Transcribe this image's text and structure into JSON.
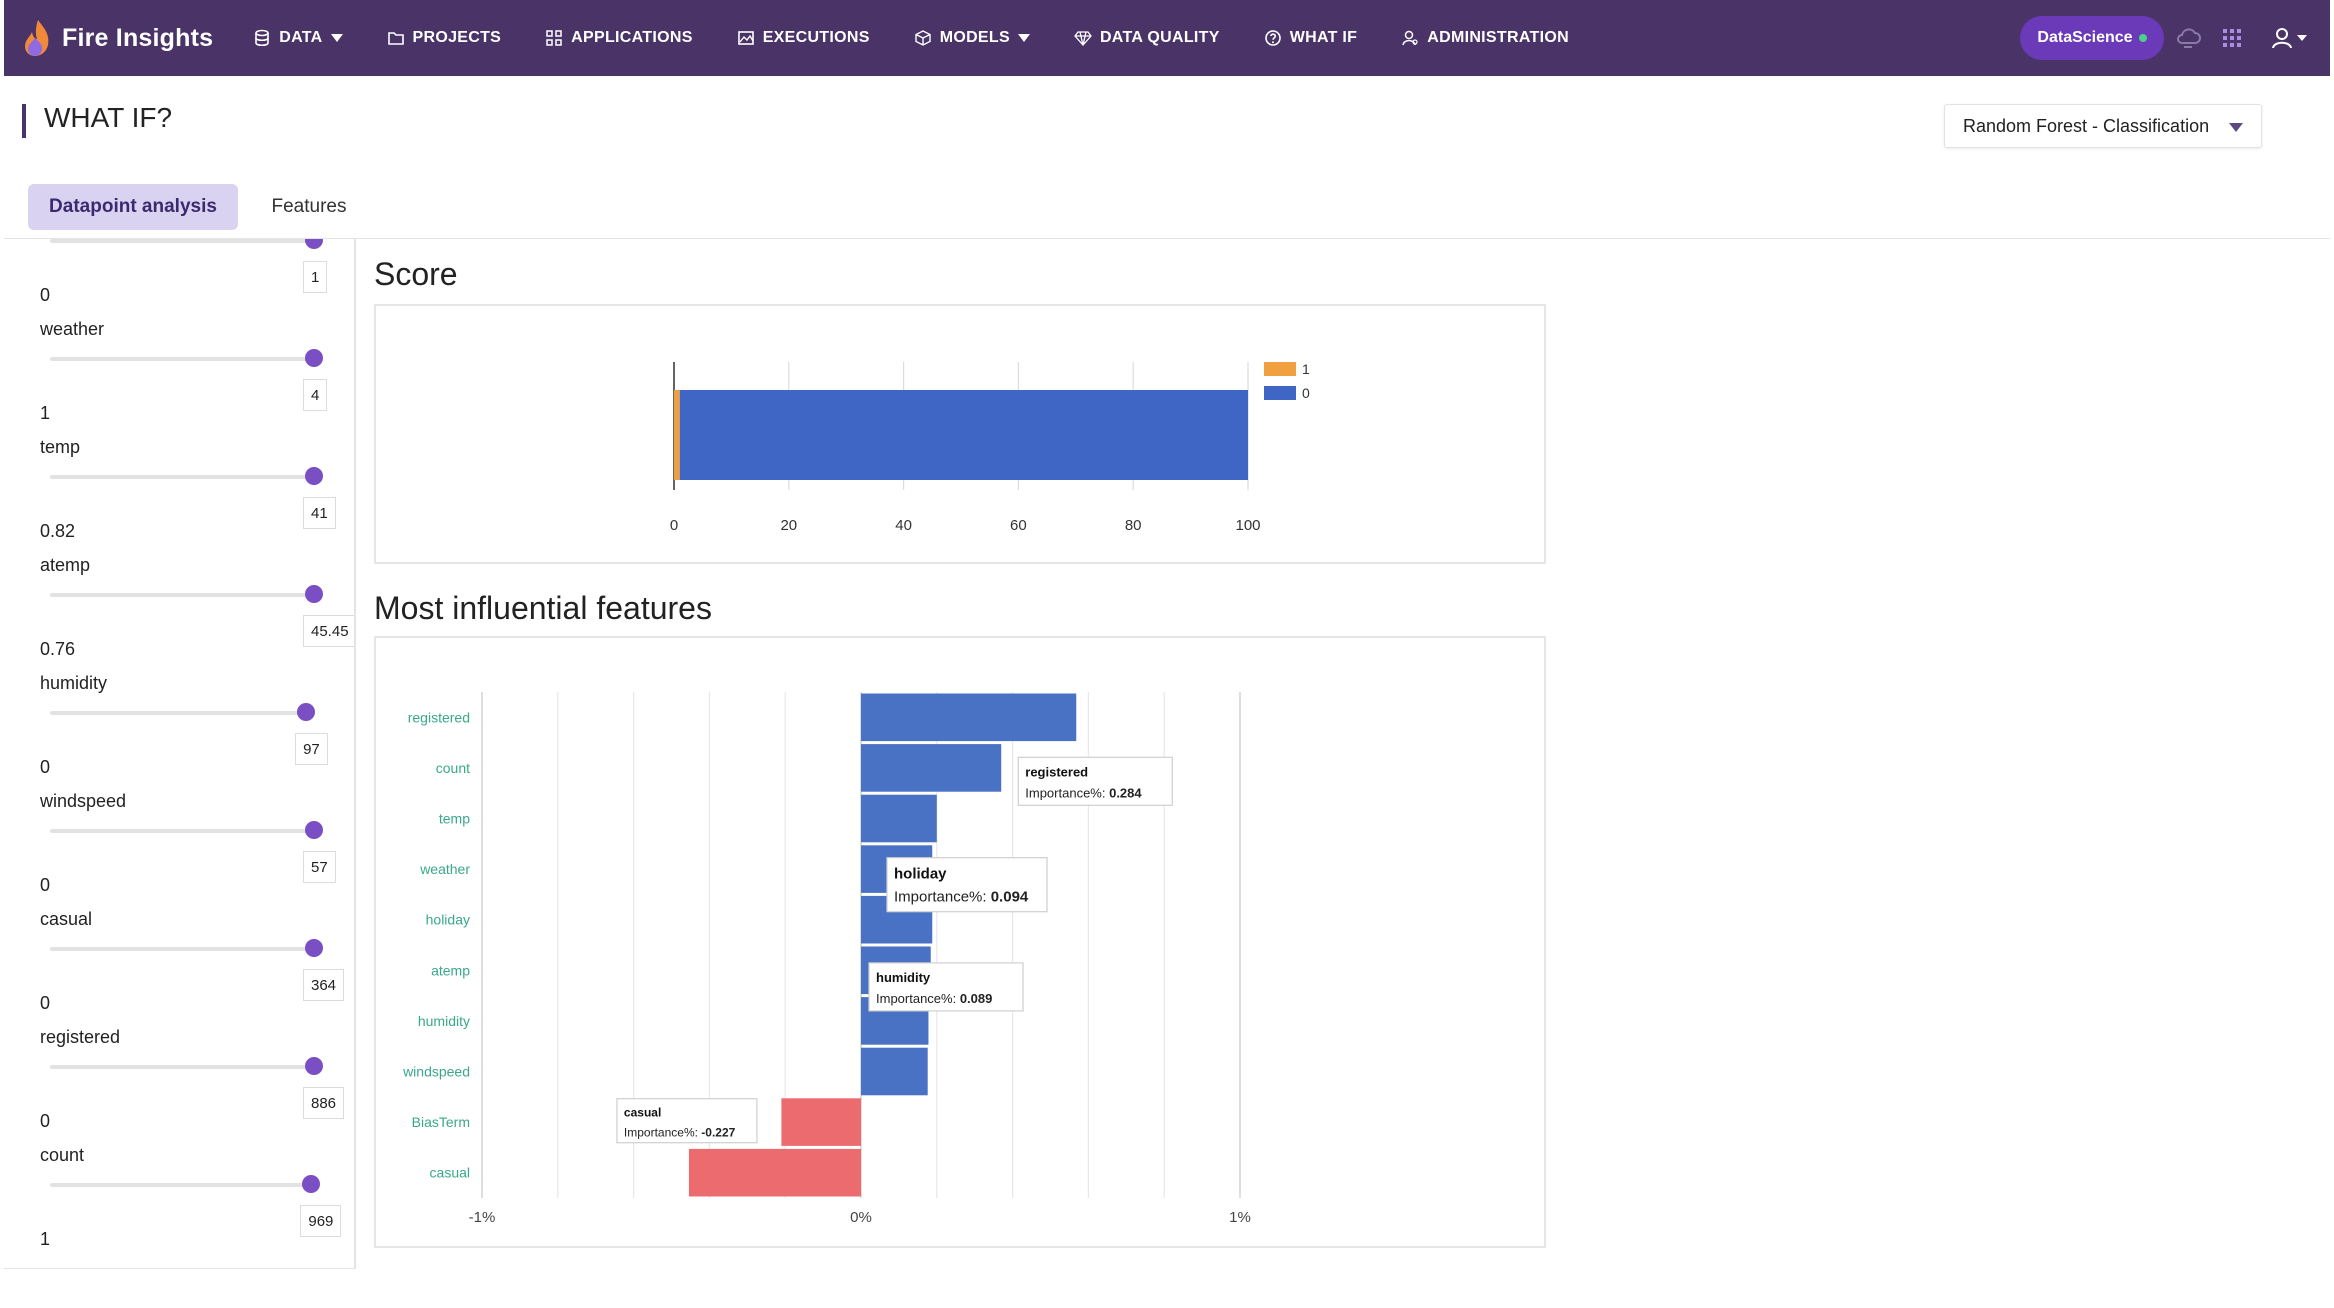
{
  "app": {
    "title": "Fire Insights",
    "nav": [
      {
        "label": "DATA",
        "icon": "database-icon",
        "dropdown": true
      },
      {
        "label": "PROJECTS",
        "icon": "folder-icon",
        "dropdown": false
      },
      {
        "label": "APPLICATIONS",
        "icon": "apps-grid-icon",
        "dropdown": false
      },
      {
        "label": "EXECUTIONS",
        "icon": "image-chart-icon",
        "dropdown": false
      },
      {
        "label": "MODELS",
        "icon": "cube-icon",
        "dropdown": true
      },
      {
        "label": "DATA QUALITY",
        "icon": "diamond-icon",
        "dropdown": false
      },
      {
        "label": "WHAT IF",
        "icon": "question-circle-icon",
        "dropdown": false
      },
      {
        "label": "ADMINISTRATION",
        "icon": "user-admin-icon",
        "dropdown": false
      }
    ],
    "workspace_badge": "DataScience",
    "status_color": "#4ad08a",
    "accent": "#4a3367"
  },
  "page": {
    "title": "WHAT IF?",
    "model_select": "Random Forest - Classification",
    "tabs": [
      "Datapoint analysis",
      "Features"
    ],
    "active_tab": 0
  },
  "features": [
    {
      "name": "",
      "value": "0",
      "tooltip": "1",
      "level": 1.0,
      "partial": true
    },
    {
      "name": "weather",
      "value": "1",
      "tooltip": "4",
      "level": 1.0
    },
    {
      "name": "temp",
      "value": "0.82",
      "tooltip": "41",
      "level": 1.0
    },
    {
      "name": "atemp",
      "value": "0.76",
      "tooltip": "45.45",
      "level": 1.0
    },
    {
      "name": "humidity",
      "value": "0",
      "tooltip": "97",
      "level": 0.97
    },
    {
      "name": "windspeed",
      "value": "0",
      "tooltip": "57",
      "level": 1.0
    },
    {
      "name": "casual",
      "value": "0",
      "tooltip": "364",
      "level": 1.0
    },
    {
      "name": "registered",
      "value": "0",
      "tooltip": "886",
      "level": 1.0
    },
    {
      "name": "count",
      "value": "1",
      "tooltip": "969",
      "level": 0.99
    }
  ],
  "score": {
    "title": "Score"
  },
  "influence": {
    "title": "Most influential features"
  },
  "chart_data": [
    {
      "type": "bar",
      "orientation": "horizontal",
      "stacked": true,
      "title": "Score",
      "xlim": [
        0,
        100
      ],
      "xticks": [
        0,
        20,
        40,
        60,
        80,
        100
      ],
      "series": [
        {
          "name": "1",
          "values": [
            1
          ],
          "color": "#f0a040"
        },
        {
          "name": "0",
          "values": [
            99
          ],
          "color": "#3f66c4"
        }
      ],
      "legend": "top-right",
      "grid": true
    },
    {
      "type": "bar",
      "orientation": "horizontal",
      "title": "Most influential features",
      "categories": [
        "registered",
        "count",
        "temp",
        "weather",
        "holiday",
        "atemp",
        "humidity",
        "windspeed",
        "BiasTerm",
        "casual"
      ],
      "values": [
        0.284,
        0.185,
        0.1,
        0.094,
        0.094,
        0.092,
        0.089,
        0.088,
        -0.105,
        -0.227
      ],
      "xlim": [
        -0.5,
        0.5
      ],
      "xticks": [
        "-1%",
        "0%",
        "1%"
      ],
      "positive_color": "#4a72c4",
      "negative_color": "#ec6b6e",
      "tooltips": [
        {
          "feature": "registered",
          "label": "Importance%",
          "value": "0.284"
        },
        {
          "feature": "holiday",
          "label": "Importance%",
          "value": "0.094"
        },
        {
          "feature": "humidity",
          "label": "Importance%",
          "value": "0.089"
        },
        {
          "feature": "casual",
          "label": "Importance%",
          "value": "-0.227"
        }
      ],
      "grid": true
    }
  ]
}
